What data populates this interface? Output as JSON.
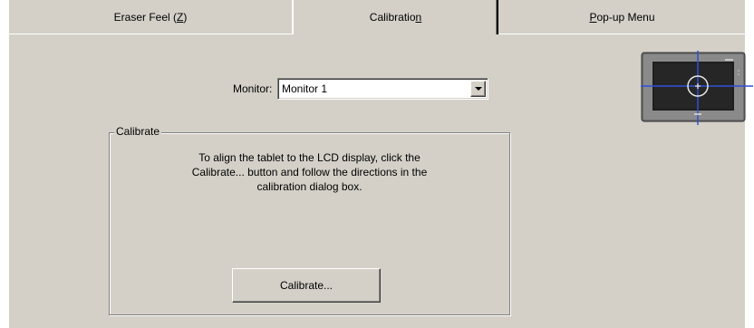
{
  "tabs": {
    "eraser_prefix": "Eraser Feel (",
    "eraser_hotkey": "Z",
    "eraser_suffix": ")",
    "calibration_prefix": "Calibratio",
    "calibration_hotkey": "n",
    "popup_hotkey": "P",
    "popup_suffix": "op-up Menu"
  },
  "monitor": {
    "label": "Monitor:",
    "selected": "Monitor 1"
  },
  "calibrate_group": {
    "title": "Calibrate",
    "line1": "To align the tablet to the LCD display, click the",
    "line2": "Calibrate... button and follow the directions in the",
    "line3": "calibration dialog box.",
    "button_label": "Calibrate..."
  },
  "icons": {
    "tablet": "tablet-calibration-icon",
    "dropdown": "chevron-down-icon"
  },
  "colors": {
    "face": "#d4d0c8",
    "crosshair": "#2a4ad0"
  }
}
